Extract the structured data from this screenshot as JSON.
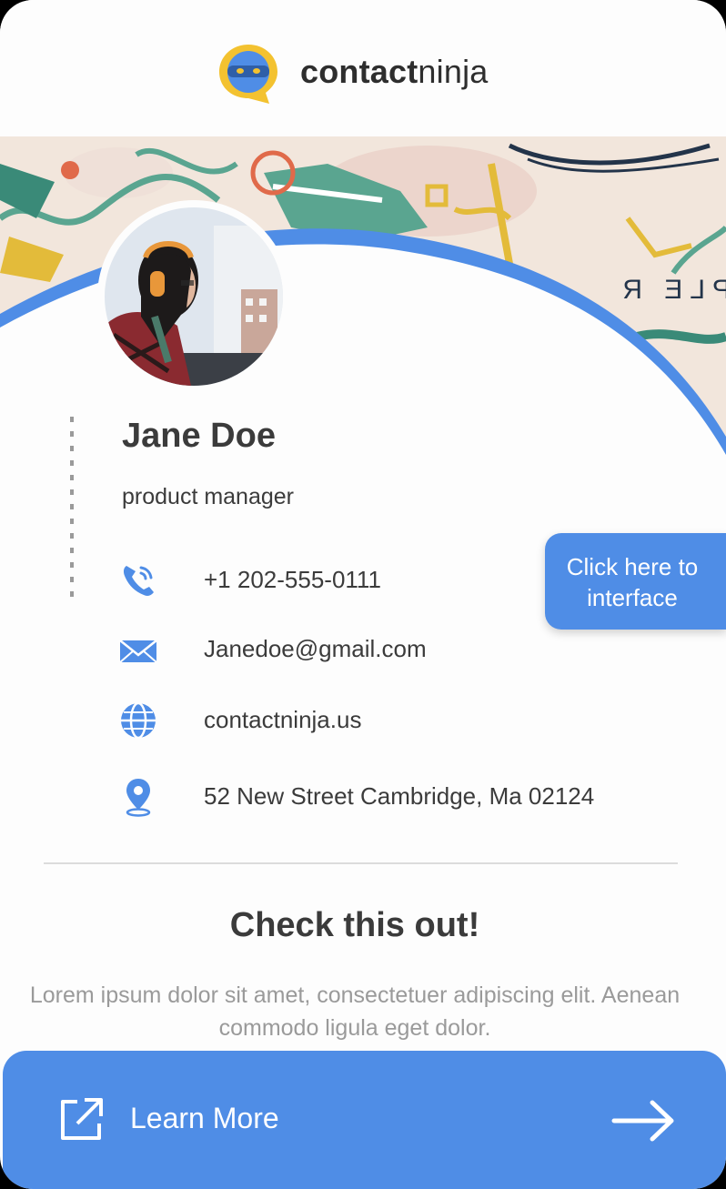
{
  "brand": {
    "name_bold": "contact",
    "name_light": "ninja"
  },
  "profile": {
    "name": "Jane Doe",
    "title": "product manager"
  },
  "contacts": [
    {
      "icon": "phone-icon",
      "value": "+1  202-555-0111"
    },
    {
      "icon": "email-icon",
      "value": "Janedoe@gmail.com"
    },
    {
      "icon": "globe-icon",
      "value": "contactninja.us"
    },
    {
      "icon": "location-pin-icon",
      "value": "52 New Street Cambridge, Ma 02124"
    }
  ],
  "callout": {
    "line1": "Click here to",
    "line2": "interface"
  },
  "section": {
    "title": "Check this out!",
    "body": "Lorem ipsum dolor sit amet, consectetuer adipiscing elit. Aenean commodo ligula eget dolor."
  },
  "footer": {
    "learn_more_label": "Learn More"
  },
  "colors": {
    "accent": "#4f8de6",
    "text": "#3b3b3b",
    "muted": "#9a9a9a",
    "logo_yellow": "#f3c230"
  }
}
